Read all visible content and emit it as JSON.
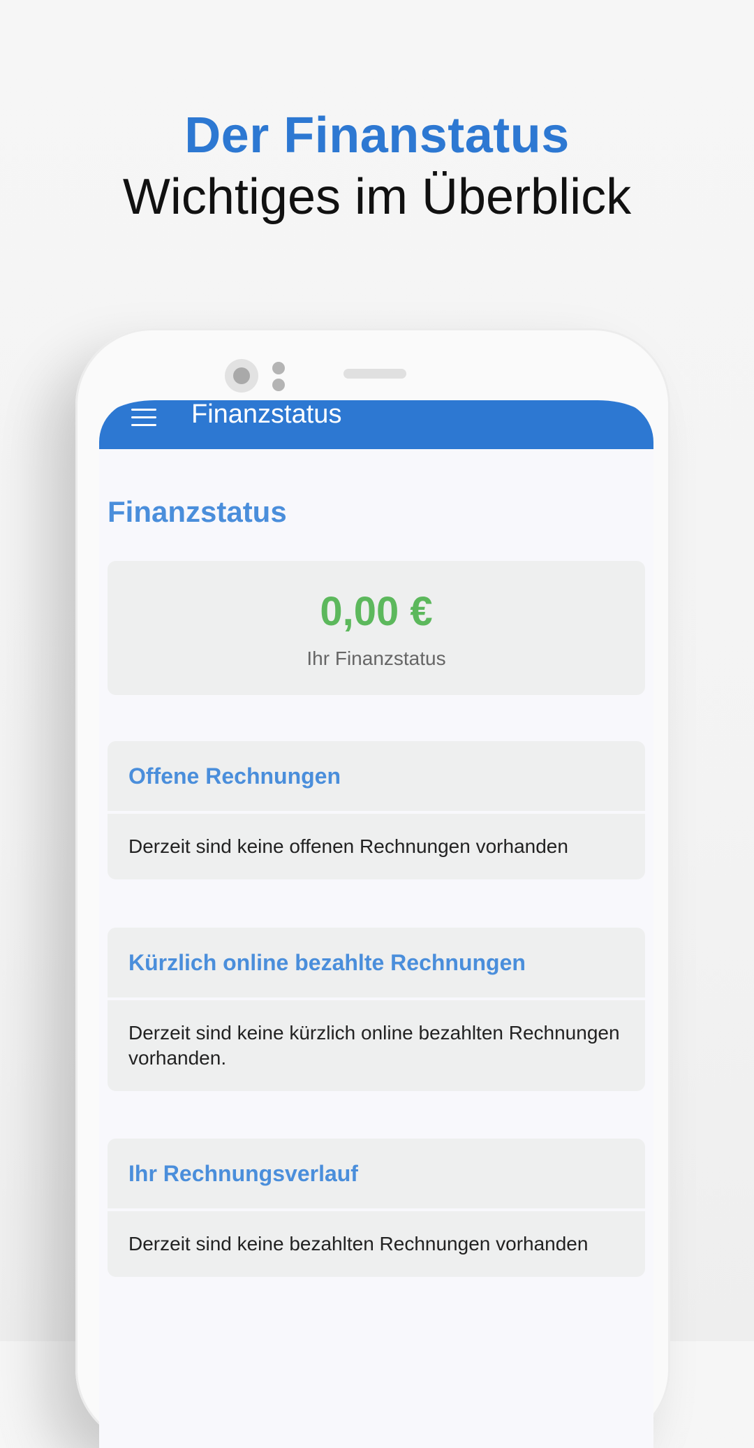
{
  "headline": {
    "title": "Der Finanstatus",
    "subtitle": "Wichtiges im Überblick"
  },
  "appbar": {
    "menu_icon": "menu-icon",
    "title": "Finanzstatus"
  },
  "page": {
    "title": "Finanzstatus"
  },
  "balance": {
    "amount": "0,00 €",
    "label": "Ihr Finanzstatus"
  },
  "sections": [
    {
      "heading": "Offene Rechnungen",
      "body": "Derzeit sind keine offenen Rechnungen vorhanden"
    },
    {
      "heading": "Kürzlich online bezahlte Rechnungen",
      "body": "Derzeit sind keine kürzlich online bezahlten Rechnungen vorhanden."
    },
    {
      "heading": "Ihr Rechnungsverlauf",
      "body": "Derzeit sind keine bezahlten Rechnungen vorhanden"
    }
  ],
  "colors": {
    "brand_blue": "#2d78d2",
    "heading_blue": "#4a8edb",
    "amount_green": "#5cb85c"
  }
}
